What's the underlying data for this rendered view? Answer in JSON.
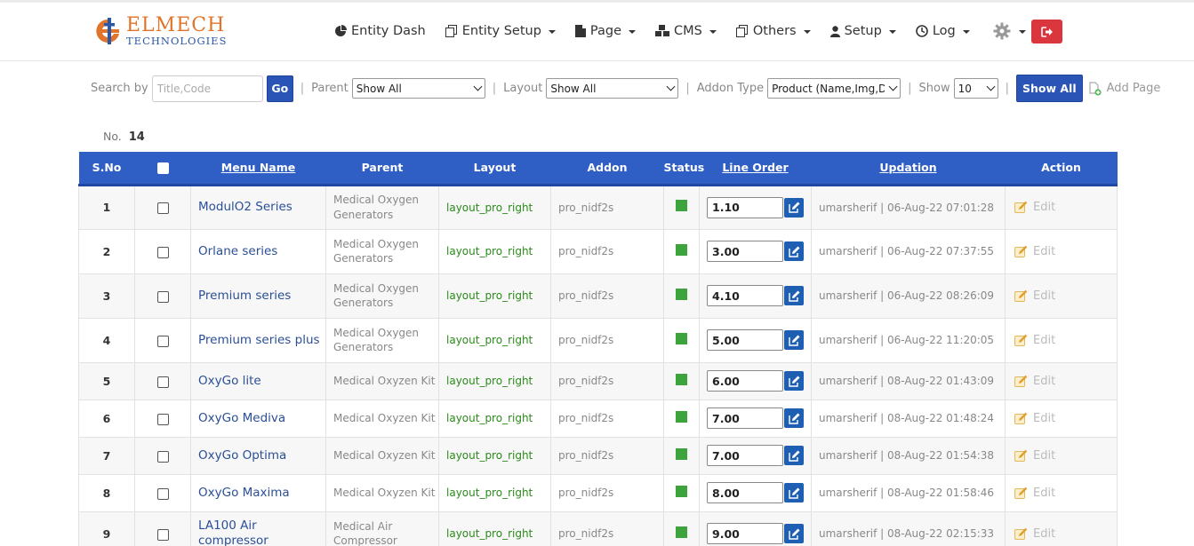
{
  "brand": {
    "name_line1": "ELMECH",
    "name_line2": "TECHNOLOGIES"
  },
  "nav": {
    "items": [
      {
        "label": "Entity Dash",
        "icon": "pie-chart-icon",
        "has_caret": false
      },
      {
        "label": "Entity Setup",
        "icon": "copy-icon",
        "has_caret": true
      },
      {
        "label": "Page",
        "icon": "file-icon",
        "has_caret": true
      },
      {
        "label": "CMS",
        "icon": "cubes-icon",
        "has_caret": true
      },
      {
        "label": "Others",
        "icon": "copy-icon",
        "has_caret": true
      },
      {
        "label": "Setup",
        "icon": "user-icon",
        "has_caret": true
      },
      {
        "label": "Log",
        "icon": "clock-icon",
        "has_caret": true
      }
    ],
    "settings_icon": "gear-icon",
    "logout_icon": "sign-out-icon"
  },
  "filters": {
    "search_label": "Search by",
    "search_placeholder": "Title,Code",
    "go_label": "Go",
    "separator": "|",
    "parent_label": "Parent",
    "parent_value": "Show All",
    "layout_label": "Layout",
    "layout_value": "Show All",
    "addon_label": "Addon Type",
    "addon_value": "Product (Name,Img,De",
    "show_label": "Show",
    "show_value": "10",
    "show_all_label": "Show All",
    "add_page_label": "Add Page"
  },
  "count": {
    "label": "No.",
    "value": "14"
  },
  "table": {
    "headers": {
      "sno": "S.No",
      "menu_name": "Menu Name",
      "parent": "Parent",
      "layout": "Layout",
      "addon": "Addon",
      "status": "Status",
      "line_order": "Line Order",
      "updation": "Updation",
      "action": "Action"
    },
    "edit_label": "Edit",
    "status_color": "#3da33d",
    "header_color": "#2f5ec4",
    "rows": [
      {
        "sno": "1",
        "name": "ModulO2 Series",
        "parent": "Medical Oxygen Generators",
        "layout": "layout_pro_right",
        "addon": "pro_nidf2s",
        "status": "active",
        "order": "1.10",
        "updation": "umarsherif | 06-Aug-22 07:01:28"
      },
      {
        "sno": "2",
        "name": "Orlane series",
        "parent": "Medical Oxygen Generators",
        "layout": "layout_pro_right",
        "addon": "pro_nidf2s",
        "status": "active",
        "order": "3.00",
        "updation": "umarsherif | 06-Aug-22 07:37:55"
      },
      {
        "sno": "3",
        "name": "Premium series",
        "parent": "Medical Oxygen Generators",
        "layout": "layout_pro_right",
        "addon": "pro_nidf2s",
        "status": "active",
        "order": "4.10",
        "updation": "umarsherif | 06-Aug-22 08:26:09"
      },
      {
        "sno": "4",
        "name": "Premium series plus",
        "parent": "Medical Oxygen Generators",
        "layout": "layout_pro_right",
        "addon": "pro_nidf2s",
        "status": "active",
        "order": "5.00",
        "updation": "umarsherif | 06-Aug-22 11:20:05"
      },
      {
        "sno": "5",
        "name": "OxyGo lite",
        "parent": "Medical Oxyzen Kit",
        "layout": "layout_pro_right",
        "addon": "pro_nidf2s",
        "status": "active",
        "order": "6.00",
        "updation": "umarsherif | 08-Aug-22 01:43:09"
      },
      {
        "sno": "6",
        "name": "OxyGo Mediva",
        "parent": "Medical Oxyzen Kit",
        "layout": "layout_pro_right",
        "addon": "pro_nidf2s",
        "status": "active",
        "order": "7.00",
        "updation": "umarsherif | 08-Aug-22 01:48:24"
      },
      {
        "sno": "7",
        "name": "OxyGo Optima",
        "parent": "Medical Oxyzen Kit",
        "layout": "layout_pro_right",
        "addon": "pro_nidf2s",
        "status": "active",
        "order": "7.00",
        "updation": "umarsherif | 08-Aug-22 01:54:38"
      },
      {
        "sno": "8",
        "name": "OxyGo Maxima",
        "parent": "Medical Oxyzen Kit",
        "layout": "layout_pro_right",
        "addon": "pro_nidf2s",
        "status": "active",
        "order": "8.00",
        "updation": "umarsherif | 08-Aug-22 01:58:46"
      },
      {
        "sno": "9",
        "name": "LA100 Air compressor",
        "parent": "Medical Air Compressor",
        "layout": "layout_pro_right",
        "addon": "pro_nidf2s",
        "status": "active",
        "order": "9.00",
        "updation": "umarsherif | 08-Aug-22 02:15:33"
      }
    ]
  }
}
